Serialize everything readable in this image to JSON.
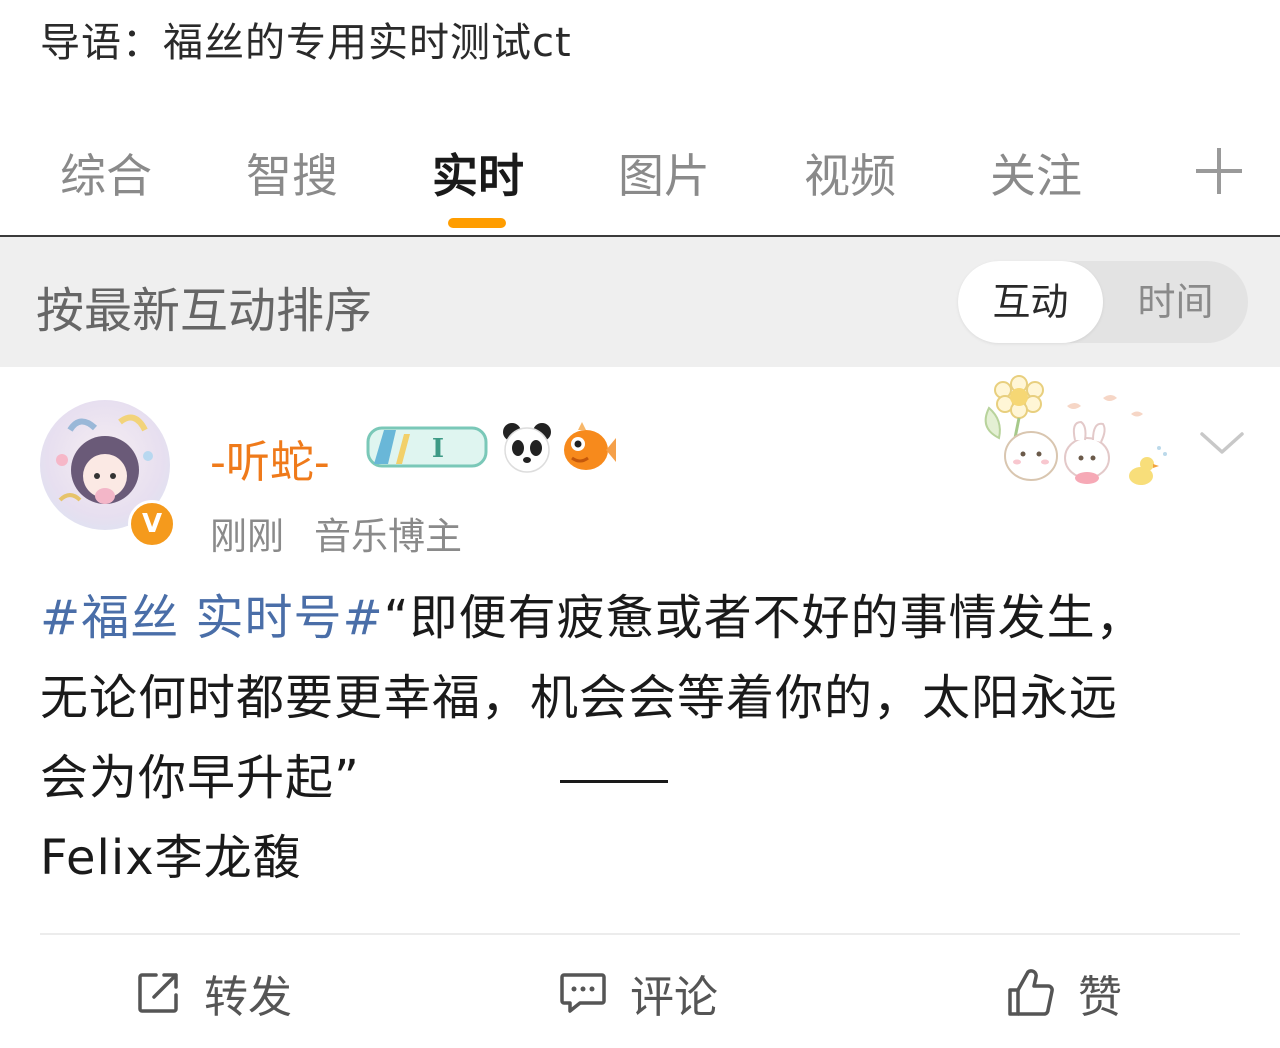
{
  "header": {
    "intro": "导语：福丝的专用实时测试ct"
  },
  "tabs": {
    "items": [
      "综合",
      "智搜",
      "实时",
      "图片",
      "视频",
      "关注"
    ],
    "active": "实时",
    "accent": "#ff9d00"
  },
  "sort": {
    "label": "按最新互动排序",
    "options": [
      "互动",
      "时间"
    ],
    "selected": "互动"
  },
  "post": {
    "username": "-听蛇-",
    "verified_badge": "V",
    "level_badge": "I",
    "time": "刚刚",
    "role": "音乐博主",
    "hashtag": "#福丝 实时号#",
    "text_line1": "“即便有疲惫或者不好的事情发生，",
    "text_line2": "无论何时都要更幸福，机会会等着你的，太阳永远",
    "text_line3": "会为你早升起”",
    "text_line4": "Felix李龙馥",
    "username_color": "#ef7a1a",
    "hashtag_color": "#4a6ea8"
  },
  "actions": {
    "repost": "转发",
    "comment": "评论",
    "like": "赞"
  },
  "icons": [
    "share-icon",
    "comment-icon",
    "like-icon",
    "chevron-down-icon",
    "plus-icon",
    "panda-emoji-icon",
    "fish-emoji-icon"
  ]
}
